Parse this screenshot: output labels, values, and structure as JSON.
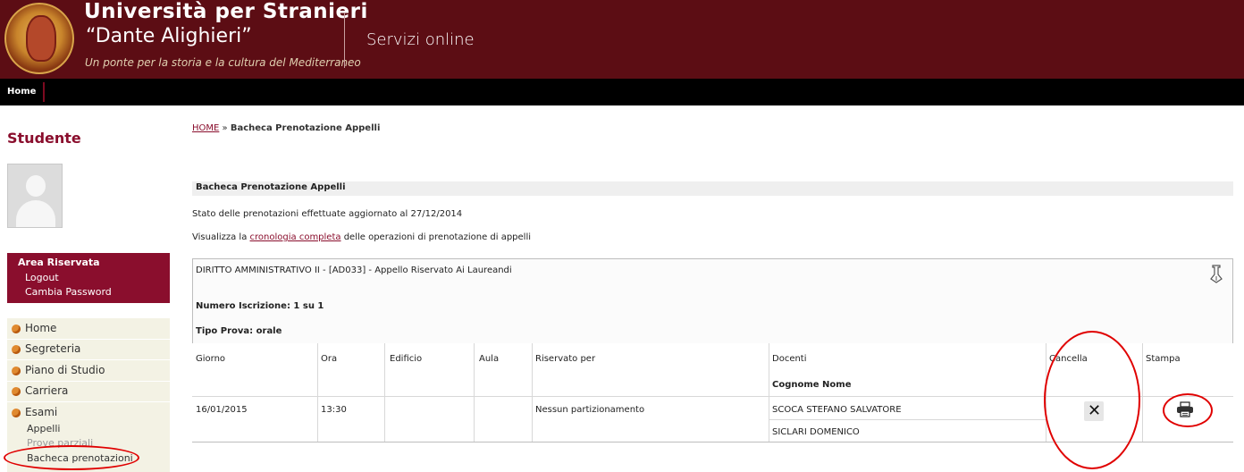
{
  "header": {
    "university_title": "Università per Stranieri",
    "university_subtitle": "“Dante Alighieri”",
    "motto": "Un ponte per la storia e la cultura del Mediterraneo",
    "services_label": "Servizi online"
  },
  "navbar": {
    "home_label": "Home"
  },
  "sidebar": {
    "student_title": "Studente",
    "area": {
      "title": "Area Riservata",
      "links": [
        "Logout",
        "Cambia Password"
      ]
    },
    "menu": [
      "Home",
      "Segreteria",
      "Piano di Studio",
      "Carriera",
      "Esami"
    ],
    "submenu": [
      "Appelli",
      "Prove parziali",
      "Bacheca prenotazioni"
    ]
  },
  "breadcrumb": {
    "home": "HOME",
    "separator": " » ",
    "current": "Bacheca Prenotazione Appelli"
  },
  "section_heading": "Bacheca Prenotazione Appelli",
  "status_line": "Stato delle prenotazioni effettuate aggiornato al 27/12/2014",
  "history": {
    "before": "Visualizza la ",
    "link": "cronologia completa",
    "after": " delle operazioni di prenotazione di appelli"
  },
  "card": {
    "title": "DIRITTO AMMINISTRATIVO II - [AD033] - Appello Riservato Ai Laureandi",
    "numero": "Numero Iscrizione: 1 su 1",
    "tipo": "Tipo Prova: orale",
    "columns": [
      "Giorno",
      "Ora",
      "Edificio",
      "Aula",
      "Riservato per",
      "Docenti",
      "Cancella",
      "Stampa"
    ],
    "docenti_sub": "Cognome Nome",
    "row": {
      "giorno": "16/01/2015",
      "ora": "13:30",
      "edificio": "",
      "aula": "",
      "riservato": "Nessun partizionamento",
      "docenti": [
        "SCOCA STEFANO SALVATORE",
        "SICLARI DOMENICO"
      ]
    }
  },
  "icons": {
    "cancel": "close-icon",
    "print": "printer-icon",
    "edit": "pen-icon",
    "menu_bullet": "orange-dot-icon"
  },
  "colors": {
    "brand": "#5c0d14",
    "accent": "#8a0e2d",
    "annotation": "#e00000"
  }
}
